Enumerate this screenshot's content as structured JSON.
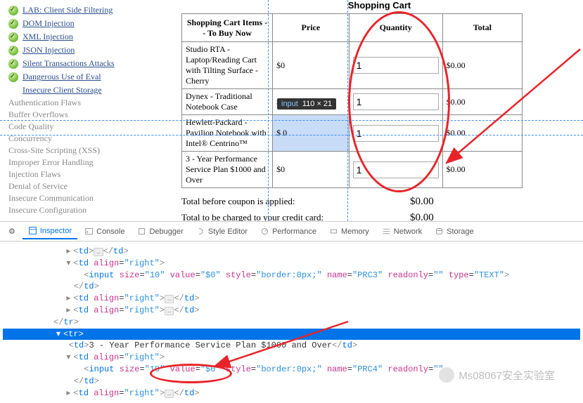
{
  "sidebar": {
    "items": [
      {
        "label": "LAB: Client Side Filtering"
      },
      {
        "label": "DOM Injection"
      },
      {
        "label": "XML Injection"
      },
      {
        "label": "JSON Injection"
      },
      {
        "label": "Silent Transactions Attacks"
      },
      {
        "label": "Dangerous Use of Eval"
      },
      {
        "label": "Insecure Client Storage"
      }
    ],
    "categories": [
      "Authentication Flaws",
      "Buffer Overflows",
      "Code Quality",
      "Concurrency",
      "Cross-Site Scripting (XSS)",
      "Improper Error Handling",
      "Injection Flaws",
      "Denial of Service",
      "Insecure Communication",
      "Insecure Configuration"
    ]
  },
  "cart": {
    "title": "Shopping Cart",
    "headers": {
      "item": "Shopping Cart Items -- To Buy Now",
      "price": "Price",
      "qty": "Quantity",
      "total": "Total"
    },
    "rows": [
      {
        "desc": "Studio RTA - Laptop/Reading Cart with Tilting Surface - Cherry",
        "price": "$0",
        "qty": "1",
        "total": "$0.00"
      },
      {
        "desc": "Dynex - Traditional Notebook Case",
        "price": "$0",
        "qty": "1",
        "total": "$0.00"
      },
      {
        "desc": "Hewlett-Packard - Pavilion Notebook with Intel® Centrino™",
        "price": "$ 0",
        "qty": "1",
        "total": "$0.00"
      },
      {
        "desc": "3 - Year Performance Service Plan $1000 and Over",
        "price": "$0",
        "qty": "1",
        "total": "$0.00"
      }
    ],
    "totals": {
      "beforeLabel": "Total before coupon is applied:",
      "beforeValue": "$0.00",
      "chargedLabel": "Total to be charged to your credit card:",
      "chargedValue": "$0.00"
    }
  },
  "tooltip": {
    "tag": "input",
    "dims": "110 × 21"
  },
  "devtools": {
    "tabs": {
      "inspector": "Inspector",
      "console": "Console",
      "debugger": "Debugger",
      "style": "Style Editor",
      "perf": "Performance",
      "memory": "Memory",
      "network": "Network",
      "storage": "Storage"
    },
    "code": {
      "td_open": "td",
      "td_close": "td",
      "tr_close": "tr",
      "tr_open": "tr",
      "align_attr": "align",
      "align_val": "\"right\"",
      "input": "input",
      "size_attr": "size",
      "size_val": "\"10\"",
      "value_attr": "value",
      "value_val": "\"$0\"",
      "style_attr": "style",
      "style_val": "\"border:0px;\"",
      "name_attr": "name",
      "name_val3": "\"PRC3\"",
      "name_val4": "\"PRC4\"",
      "readonly_attr": "readonly",
      "readonly_val": "\"\"",
      "type_attr": "type",
      "type_val": "\"TEXT\"",
      "text_row4": "3 - Year Performance Service Plan $1000 and Over"
    }
  },
  "watermark": "Ms08067安全实验室"
}
